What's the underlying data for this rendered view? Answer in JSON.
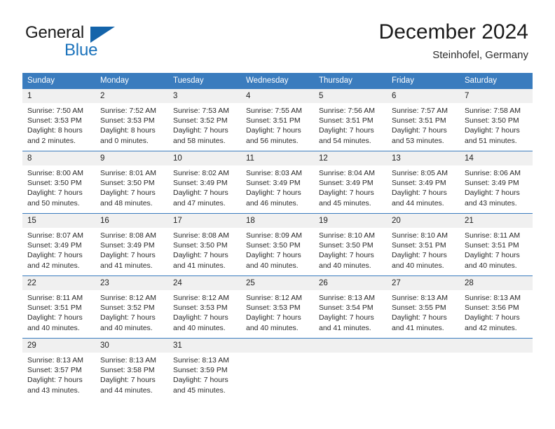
{
  "brand": {
    "name_part1": "General",
    "name_part2": "Blue",
    "accent_color": "#1a72bb",
    "triangle_color": "#1464aa"
  },
  "header": {
    "title": "December 2024",
    "subtitle": "Steinhofel, Germany",
    "header_bg": "#3a7cbe",
    "daynum_bg": "#f0f0f0"
  },
  "weekdays": [
    "Sunday",
    "Monday",
    "Tuesday",
    "Wednesday",
    "Thursday",
    "Friday",
    "Saturday"
  ],
  "labels": {
    "sunrise_prefix": "Sunrise:",
    "sunset_prefix": "Sunset:",
    "daylight_prefix": "Daylight:"
  },
  "weeks": [
    [
      {
        "day": "1",
        "sunrise": "Sunrise: 7:50 AM",
        "sunset": "Sunset: 3:53 PM",
        "daylight1": "Daylight: 8 hours",
        "daylight2": "and 2 minutes."
      },
      {
        "day": "2",
        "sunrise": "Sunrise: 7:52 AM",
        "sunset": "Sunset: 3:53 PM",
        "daylight1": "Daylight: 8 hours",
        "daylight2": "and 0 minutes."
      },
      {
        "day": "3",
        "sunrise": "Sunrise: 7:53 AM",
        "sunset": "Sunset: 3:52 PM",
        "daylight1": "Daylight: 7 hours",
        "daylight2": "and 58 minutes."
      },
      {
        "day": "4",
        "sunrise": "Sunrise: 7:55 AM",
        "sunset": "Sunset: 3:51 PM",
        "daylight1": "Daylight: 7 hours",
        "daylight2": "and 56 minutes."
      },
      {
        "day": "5",
        "sunrise": "Sunrise: 7:56 AM",
        "sunset": "Sunset: 3:51 PM",
        "daylight1": "Daylight: 7 hours",
        "daylight2": "and 54 minutes."
      },
      {
        "day": "6",
        "sunrise": "Sunrise: 7:57 AM",
        "sunset": "Sunset: 3:51 PM",
        "daylight1": "Daylight: 7 hours",
        "daylight2": "and 53 minutes."
      },
      {
        "day": "7",
        "sunrise": "Sunrise: 7:58 AM",
        "sunset": "Sunset: 3:50 PM",
        "daylight1": "Daylight: 7 hours",
        "daylight2": "and 51 minutes."
      }
    ],
    [
      {
        "day": "8",
        "sunrise": "Sunrise: 8:00 AM",
        "sunset": "Sunset: 3:50 PM",
        "daylight1": "Daylight: 7 hours",
        "daylight2": "and 50 minutes."
      },
      {
        "day": "9",
        "sunrise": "Sunrise: 8:01 AM",
        "sunset": "Sunset: 3:50 PM",
        "daylight1": "Daylight: 7 hours",
        "daylight2": "and 48 minutes."
      },
      {
        "day": "10",
        "sunrise": "Sunrise: 8:02 AM",
        "sunset": "Sunset: 3:49 PM",
        "daylight1": "Daylight: 7 hours",
        "daylight2": "and 47 minutes."
      },
      {
        "day": "11",
        "sunrise": "Sunrise: 8:03 AM",
        "sunset": "Sunset: 3:49 PM",
        "daylight1": "Daylight: 7 hours",
        "daylight2": "and 46 minutes."
      },
      {
        "day": "12",
        "sunrise": "Sunrise: 8:04 AM",
        "sunset": "Sunset: 3:49 PM",
        "daylight1": "Daylight: 7 hours",
        "daylight2": "and 45 minutes."
      },
      {
        "day": "13",
        "sunrise": "Sunrise: 8:05 AM",
        "sunset": "Sunset: 3:49 PM",
        "daylight1": "Daylight: 7 hours",
        "daylight2": "and 44 minutes."
      },
      {
        "day": "14",
        "sunrise": "Sunrise: 8:06 AM",
        "sunset": "Sunset: 3:49 PM",
        "daylight1": "Daylight: 7 hours",
        "daylight2": "and 43 minutes."
      }
    ],
    [
      {
        "day": "15",
        "sunrise": "Sunrise: 8:07 AM",
        "sunset": "Sunset: 3:49 PM",
        "daylight1": "Daylight: 7 hours",
        "daylight2": "and 42 minutes."
      },
      {
        "day": "16",
        "sunrise": "Sunrise: 8:08 AM",
        "sunset": "Sunset: 3:49 PM",
        "daylight1": "Daylight: 7 hours",
        "daylight2": "and 41 minutes."
      },
      {
        "day": "17",
        "sunrise": "Sunrise: 8:08 AM",
        "sunset": "Sunset: 3:50 PM",
        "daylight1": "Daylight: 7 hours",
        "daylight2": "and 41 minutes."
      },
      {
        "day": "18",
        "sunrise": "Sunrise: 8:09 AM",
        "sunset": "Sunset: 3:50 PM",
        "daylight1": "Daylight: 7 hours",
        "daylight2": "and 40 minutes."
      },
      {
        "day": "19",
        "sunrise": "Sunrise: 8:10 AM",
        "sunset": "Sunset: 3:50 PM",
        "daylight1": "Daylight: 7 hours",
        "daylight2": "and 40 minutes."
      },
      {
        "day": "20",
        "sunrise": "Sunrise: 8:10 AM",
        "sunset": "Sunset: 3:51 PM",
        "daylight1": "Daylight: 7 hours",
        "daylight2": "and 40 minutes."
      },
      {
        "day": "21",
        "sunrise": "Sunrise: 8:11 AM",
        "sunset": "Sunset: 3:51 PM",
        "daylight1": "Daylight: 7 hours",
        "daylight2": "and 40 minutes."
      }
    ],
    [
      {
        "day": "22",
        "sunrise": "Sunrise: 8:11 AM",
        "sunset": "Sunset: 3:51 PM",
        "daylight1": "Daylight: 7 hours",
        "daylight2": "and 40 minutes."
      },
      {
        "day": "23",
        "sunrise": "Sunrise: 8:12 AM",
        "sunset": "Sunset: 3:52 PM",
        "daylight1": "Daylight: 7 hours",
        "daylight2": "and 40 minutes."
      },
      {
        "day": "24",
        "sunrise": "Sunrise: 8:12 AM",
        "sunset": "Sunset: 3:53 PM",
        "daylight1": "Daylight: 7 hours",
        "daylight2": "and 40 minutes."
      },
      {
        "day": "25",
        "sunrise": "Sunrise: 8:12 AM",
        "sunset": "Sunset: 3:53 PM",
        "daylight1": "Daylight: 7 hours",
        "daylight2": "and 40 minutes."
      },
      {
        "day": "26",
        "sunrise": "Sunrise: 8:13 AM",
        "sunset": "Sunset: 3:54 PM",
        "daylight1": "Daylight: 7 hours",
        "daylight2": "and 41 minutes."
      },
      {
        "day": "27",
        "sunrise": "Sunrise: 8:13 AM",
        "sunset": "Sunset: 3:55 PM",
        "daylight1": "Daylight: 7 hours",
        "daylight2": "and 41 minutes."
      },
      {
        "day": "28",
        "sunrise": "Sunrise: 8:13 AM",
        "sunset": "Sunset: 3:56 PM",
        "daylight1": "Daylight: 7 hours",
        "daylight2": "and 42 minutes."
      }
    ],
    [
      {
        "day": "29",
        "sunrise": "Sunrise: 8:13 AM",
        "sunset": "Sunset: 3:57 PM",
        "daylight1": "Daylight: 7 hours",
        "daylight2": "and 43 minutes."
      },
      {
        "day": "30",
        "sunrise": "Sunrise: 8:13 AM",
        "sunset": "Sunset: 3:58 PM",
        "daylight1": "Daylight: 7 hours",
        "daylight2": "and 44 minutes."
      },
      {
        "day": "31",
        "sunrise": "Sunrise: 8:13 AM",
        "sunset": "Sunset: 3:59 PM",
        "daylight1": "Daylight: 7 hours",
        "daylight2": "and 45 minutes."
      },
      {
        "day": "",
        "sunrise": "",
        "sunset": "",
        "daylight1": "",
        "daylight2": ""
      },
      {
        "day": "",
        "sunrise": "",
        "sunset": "",
        "daylight1": "",
        "daylight2": ""
      },
      {
        "day": "",
        "sunrise": "",
        "sunset": "",
        "daylight1": "",
        "daylight2": ""
      },
      {
        "day": "",
        "sunrise": "",
        "sunset": "",
        "daylight1": "",
        "daylight2": ""
      }
    ]
  ]
}
